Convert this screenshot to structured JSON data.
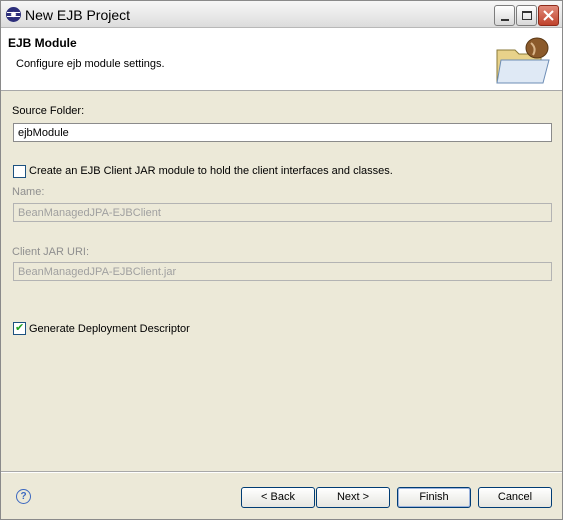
{
  "window": {
    "title": "New EJB Project"
  },
  "banner": {
    "title": "EJB Module",
    "description": "Configure ejb module settings."
  },
  "form": {
    "source_folder_label": "Source Folder:",
    "source_folder_value": "ejbModule",
    "client_jar_checkbox_label": "Create an EJB Client JAR module to hold the client interfaces and classes.",
    "client_jar_checked": false,
    "name_label": "Name:",
    "name_value": "BeanManagedJPA-EJBClient",
    "client_jar_uri_label": "Client JAR URI:",
    "client_jar_uri_value": "BeanManagedJPA-EJBClient.jar",
    "deployment_descriptor_label": "Generate Deployment Descriptor",
    "deployment_descriptor_checked": true
  },
  "buttons": {
    "back": "< Back",
    "next": "Next >",
    "finish": "Finish",
    "cancel": "Cancel"
  },
  "icons": {
    "help": "?",
    "checkmark": "✔"
  },
  "colors": {
    "dialog_bg": "#ece9d8",
    "banner_bg": "#ffffff",
    "disabled_text": "#8f8f8f",
    "checkmark": "#21a121"
  }
}
